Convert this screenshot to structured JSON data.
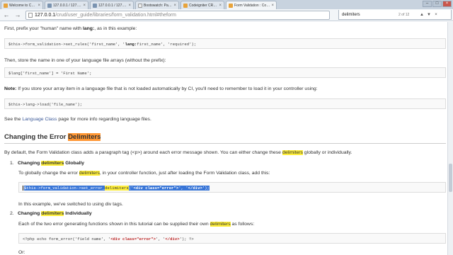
{
  "browser": {
    "tabs": [
      {
        "title": "Welcome to CodeIgniter",
        "icon": "codeigniter-favicon"
      },
      {
        "title": "127.0.0.1 / 127.0.0.1 / cre",
        "icon": "phpmyadmin-favicon"
      },
      {
        "title": "127.0.0.1 / 127.0.0.1 / cre",
        "icon": "phpmyadmin-favicon"
      },
      {
        "title": "Bootswatch: Paper",
        "icon": "bootswatch-favicon"
      },
      {
        "title": "Codeigniter CRUD Applic",
        "icon": "codeigniter-favicon"
      },
      {
        "title": "Form Validation : CodeIg",
        "icon": "codeigniter-favicon"
      }
    ],
    "active_tab_index": 5,
    "url_host": "127.0.0.1",
    "url_path": "/crud/user_guide/libraries/form_validation.html#theform",
    "find_query": "delimiters",
    "find_count": "2 of 12"
  },
  "doc": {
    "line1_pre": "First, prefix your \"human\" name with ",
    "line1_bold": "lang:",
    "line1_post": ", as in this example:",
    "code1_pre": "$this->form_validation->set_rules('first_name', '",
    "code1_bold": "lang:",
    "code1_post": "first_name', 'required');",
    "line2": "Then, store the name in one of your language file arrays (without the prefix):",
    "code2": "$lang['first_name'] = 'First Name';",
    "note_label": "Note:",
    "note_text": " If you store your array item in a language file that is not loaded automatically by CI, you'll need to remember to load it in your controller using:",
    "code3": "$this->lang->load('file_name');",
    "see_pre": "See the ",
    "see_link": "Language Class",
    "see_post": " page for more info regarding language files.",
    "h2_pre": "Changing the Error ",
    "h2_hl": "Delimiters",
    "intro_pre": "By default, the Form Validation class adds a paragraph tag (<p>) around each error message shown. You can either change these ",
    "intro_hl": "delimiters",
    "intro_post": " globally or individually.",
    "item1_num": "1.",
    "item1_pre": "Changing ",
    "item1_hl": "delimiters",
    "item1_post": " Globally",
    "item1_desc_pre": "To globally change the error ",
    "item1_desc_hl": "delimiters",
    "item1_desc_post": ", in your controller function, just after loading the Form Validation class, add this:",
    "code4_pre": "$this->form_validation->set_error_",
    "code4_hl": "delimiters",
    "code4_open": "('",
    "code4_s1": "<div class=\"error\">",
    "code4_mid": "', '",
    "code4_s2": "</div>",
    "code4_close": "');",
    "item1_after": "In this example, we've switched to using div tags.",
    "item2_num": "2.",
    "item2_pre": "Changing ",
    "item2_hl": "delimiters",
    "item2_post": " Individually",
    "item2_desc_pre": "Each of the two error generating functions shown in this tutorial can be supplied their own ",
    "item2_desc_hl": "delimiters",
    "item2_desc_post": " as follows:",
    "code5_pre": "<?php echo form_error('field name', '",
    "code5_s1": "<div class=\"error\">",
    "code5_mid": "', '",
    "code5_s2": "</div>",
    "code5_post": "'); ?>",
    "last_line": "Or:"
  }
}
